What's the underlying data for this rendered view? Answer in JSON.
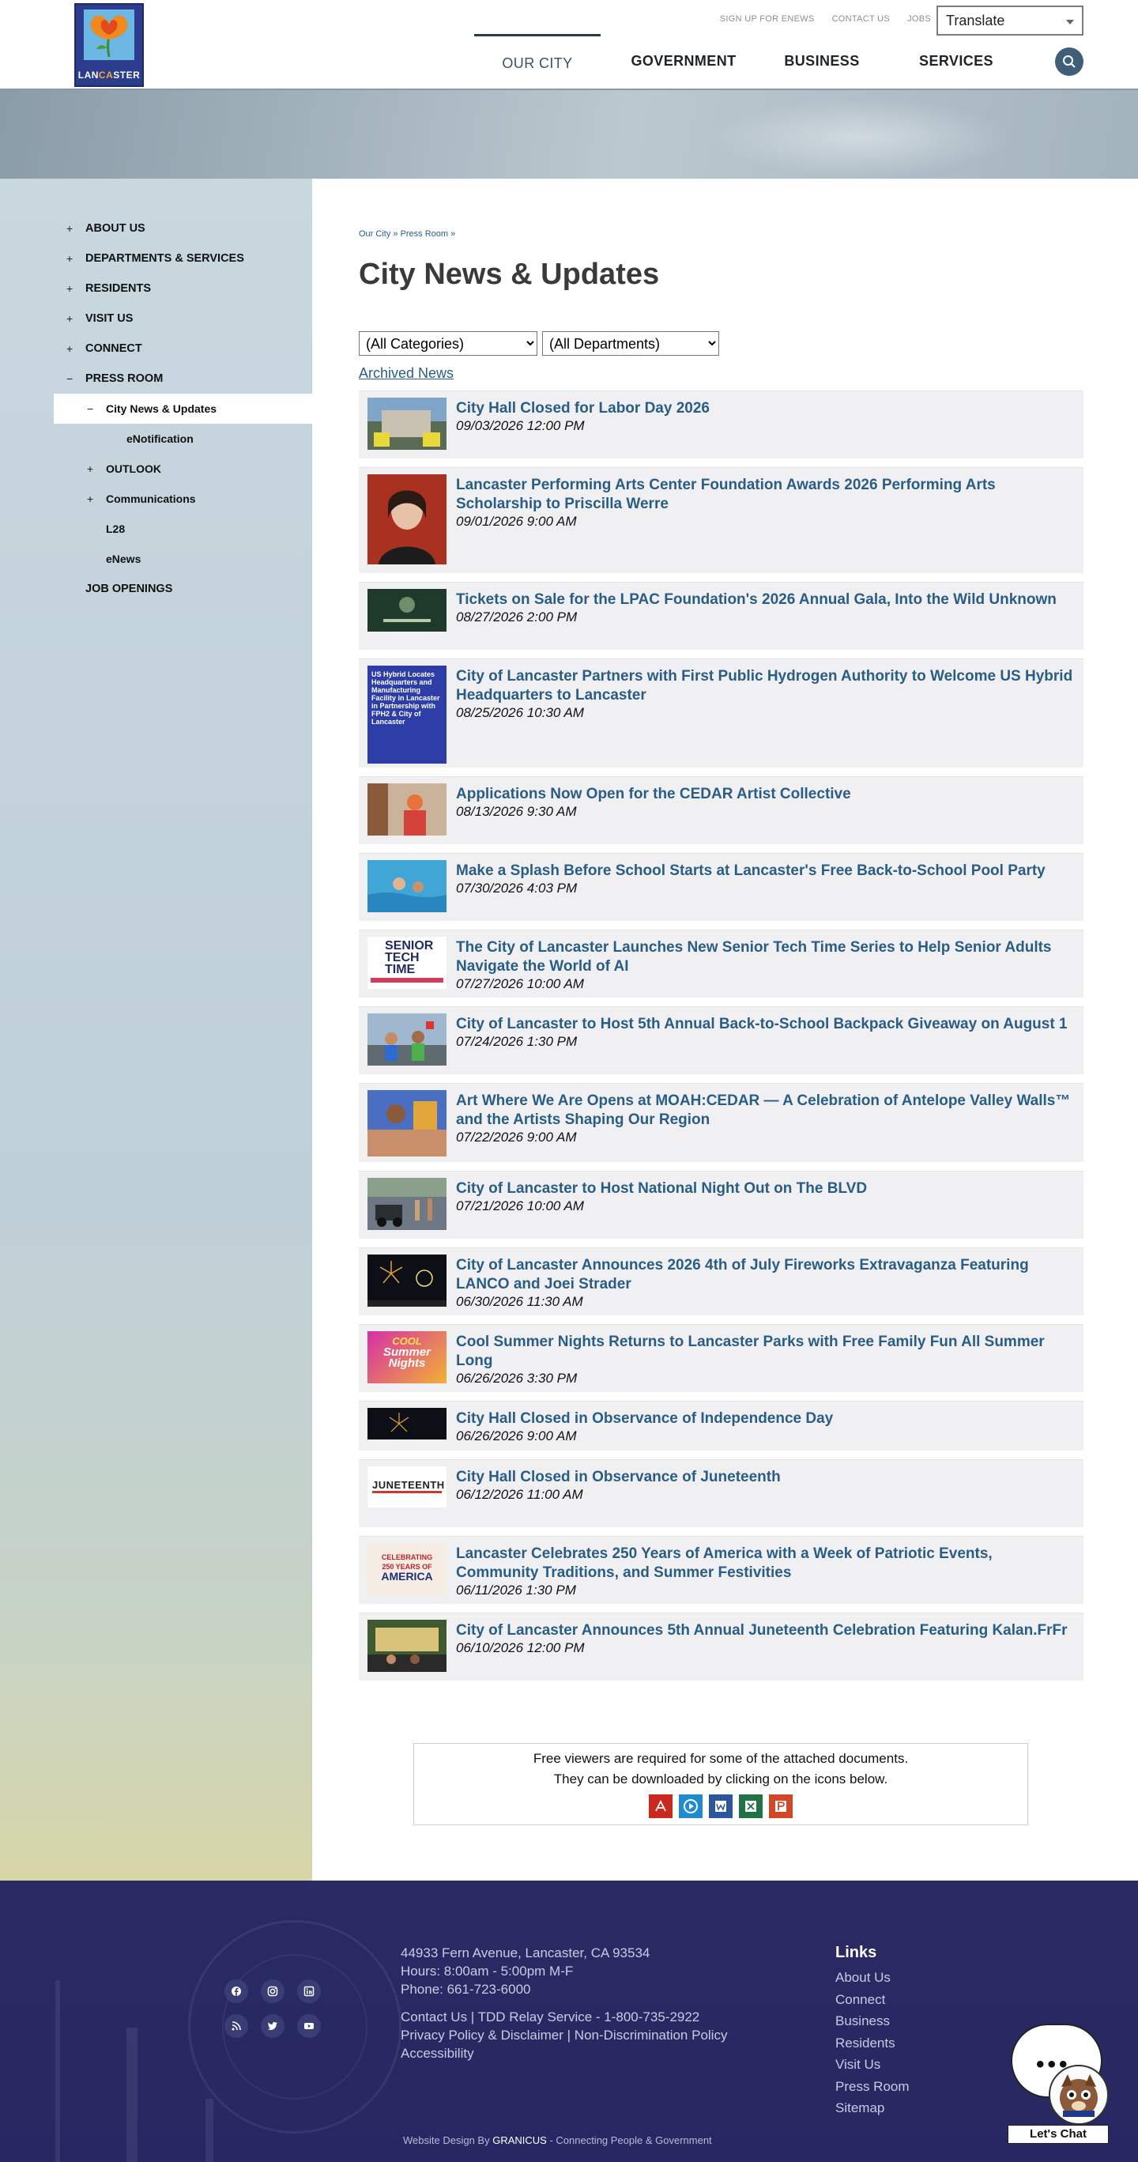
{
  "header": {
    "logo_text_a": "LAN",
    "logo_text_b": "CA",
    "logo_text_c": "STER",
    "utility_links": [
      "SIGN UP FOR ENEWS",
      "CONTACT US",
      "JOBS"
    ],
    "translate_label": "Translate",
    "nav": [
      "OUR CITY",
      "GOVERNMENT",
      "BUSINESS",
      "SERVICES"
    ]
  },
  "sidebar": {
    "items": [
      {
        "label": "ABOUT US",
        "marker": "+"
      },
      {
        "label": "DEPARTMENTS & SERVICES",
        "marker": "+"
      },
      {
        "label": "RESIDENTS",
        "marker": "+"
      },
      {
        "label": "VISIT US",
        "marker": "+"
      },
      {
        "label": "CONNECT",
        "marker": "+"
      },
      {
        "label": "PRESS ROOM",
        "marker": "−"
      },
      {
        "label": "City News & Updates",
        "marker": "−"
      },
      {
        "label": "eNotification",
        "marker": ""
      },
      {
        "label": "OUTLOOK",
        "marker": "+"
      },
      {
        "label": "Communications",
        "marker": "+"
      },
      {
        "label": "L28",
        "marker": ""
      },
      {
        "label": "eNews",
        "marker": ""
      },
      {
        "label": "JOB OPENINGS",
        "marker": ""
      }
    ]
  },
  "main": {
    "breadcrumb": "Our City » Press Room »",
    "title": "City News & Updates",
    "category_filter": "(All Categories)",
    "department_filter": "(All Departments)",
    "archived_link": "Archived News",
    "news": [
      {
        "title": "City Hall Closed for Labor Day 2026",
        "date": "09/03/2026 12:00 PM"
      },
      {
        "title": "Lancaster Performing Arts Center Foundation Awards 2026 Performing Arts Scholarship to Priscilla Werre",
        "date": "09/01/2026 9:00 AM"
      },
      {
        "title": "Tickets on Sale for the LPAC Foundation's 2026 Annual Gala, Into the Wild Unknown",
        "date": "08/27/2026 2:00 PM"
      },
      {
        "title": "City of Lancaster Partners with First Public Hydrogen Authority to Welcome US Hybrid Headquarters to Lancaster",
        "date": "08/25/2026 10:30 AM"
      },
      {
        "title": "Applications Now Open for the CEDAR Artist Collective",
        "date": "08/13/2026 9:30 AM"
      },
      {
        "title": "Make a Splash Before School Starts at Lancaster's Free Back-to-School Pool Party",
        "date": "07/30/2026 4:03 PM"
      },
      {
        "title": "The City of Lancaster Launches New Senior Tech Time Series to Help Senior Adults Navigate the World of AI",
        "date": "07/27/2026 10:00 AM"
      },
      {
        "title": "City of Lancaster to Host 5th Annual Back-to-School Backpack Giveaway on August 1",
        "date": "07/24/2026 1:30 PM"
      },
      {
        "title": "Art Where We Are Opens at MOAH:CEDAR — A Celebration of Antelope Valley Walls™ and the Artists Shaping Our Region",
        "date": "07/22/2026 9:00 AM"
      },
      {
        "title": "City of Lancaster to Host National Night Out on The BLVD",
        "date": "07/21/2026 10:00 AM"
      },
      {
        "title": "City of Lancaster Announces 2026 4th of July Fireworks Extravaganza Featuring LANCO and Joei Strader",
        "date": "06/30/2026 11:30 AM"
      },
      {
        "title": "Cool Summer Nights Returns to Lancaster Parks with Free Family Fun All Summer Long",
        "date": "06/26/2026 3:30 PM"
      },
      {
        "title": "City Hall Closed in Observance of Independence Day",
        "date": "06/26/2026 9:00 AM"
      },
      {
        "title": "City Hall Closed in Observance of Juneteenth",
        "date": "06/12/2026 11:00 AM"
      },
      {
        "title": "Lancaster Celebrates 250 Years of America with a Week of Patriotic Events, Community Traditions, and Summer Festivities",
        "date": "06/11/2026 1:30 PM"
      },
      {
        "title": "City of Lancaster Announces 5th Annual Juneteenth Celebration Featuring Kalan.FrFr",
        "date": "06/10/2026 12:00 PM"
      }
    ],
    "thumb_texts": {
      "hydrogen": "US Hybrid Locates Headquarters and Manufacturing Facility in Lancaster in Partnership with FPH2 & City of Lancaster",
      "senior_a": "SENIOR",
      "senior_b": "TECH TIME",
      "cool_a": "COOL",
      "cool_b": "Summer",
      "cool_c": "Nights",
      "juneteenth": "JUNETEENTH",
      "america_a": "CELEBRATING",
      "america_b": "250 YEARS OF",
      "america_c": "AMERICA"
    },
    "viewers_line1": "Free viewers are required for some of the attached documents.",
    "viewers_line2": "They can be downloaded by clicking on the icons below."
  },
  "footer": {
    "address": "44933 Fern Avenue, Lancaster, CA 93534",
    "hours": "Hours: 8:00am - 5:00pm M-F",
    "phone": "Phone: 661-723-6000",
    "line_contact": "Contact Us | TDD Relay Service - 1-800-735-2922",
    "line_privacy": "Privacy Policy & Disclaimer | Non-Discrimination Policy",
    "line_access": "Accessibility",
    "links_title": "Links",
    "links": [
      "About Us",
      "Connect",
      "Business",
      "Residents",
      "Visit Us",
      "Press Room",
      "Sitemap"
    ],
    "credit_a": "Website Design By ",
    "credit_b": "GRANICUS",
    "credit_c": " - Connecting People & Government",
    "chat_label": "Let's Chat",
    "chat_dots": "•••"
  },
  "colors": {
    "link": "#2a5d86",
    "footer_bg": "#2a2b63",
    "item_bg": "#f0f0f3"
  }
}
